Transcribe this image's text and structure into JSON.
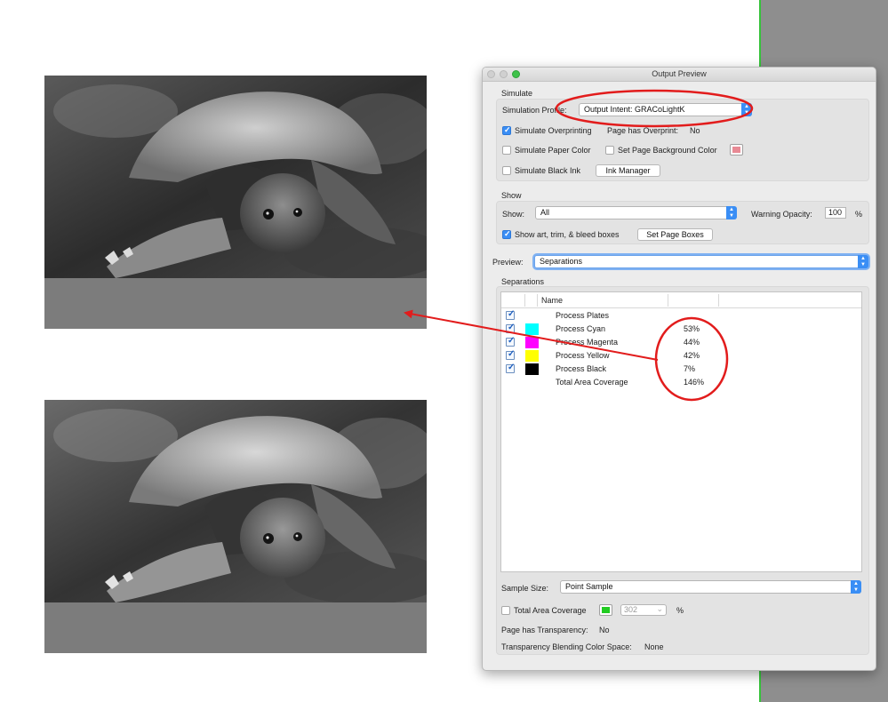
{
  "colors": {
    "annotation_red": "#e21c1c",
    "cyan": "#00ffff",
    "magenta": "#ff00ff",
    "yellow": "#ffff00",
    "black": "#000000",
    "green_swatch": "#22cc22",
    "pink_swatch": "#e88a95"
  },
  "dialog": {
    "title": "Output Preview",
    "simulate": {
      "section_label": "Simulate",
      "profile_label": "Simulation Profile:",
      "profile_value": "Output Intent: GRACoLightK",
      "simulate_overprinting_label": "Simulate Overprinting",
      "simulate_overprinting_checked": true,
      "page_has_overprint_label": "Page has Overprint:",
      "page_has_overprint_value": "No",
      "simulate_paper_color_label": "Simulate Paper Color",
      "set_page_bg_label": "Set Page Background Color",
      "simulate_black_ink_label": "Simulate Black Ink",
      "ink_manager_label": "Ink Manager"
    },
    "show": {
      "section_label": "Show",
      "show_label": "Show:",
      "show_value": "All",
      "warning_opacity_label": "Warning Opacity:",
      "warning_opacity_value": "100",
      "percent": "%",
      "show_boxes_label": "Show art, trim, & bleed boxes",
      "show_boxes_checked": true,
      "set_page_boxes_label": "Set Page Boxes"
    },
    "preview": {
      "label": "Preview:",
      "value": "Separations"
    },
    "separations": {
      "section_label": "Separations",
      "column_name": "Name",
      "rows": [
        {
          "name": "Process Plates",
          "percent": "",
          "swatch": ""
        },
        {
          "name": "Process Cyan",
          "percent": "53%",
          "swatch": "#00ffff"
        },
        {
          "name": "Process Magenta",
          "percent": "44%",
          "swatch": "#ff00ff"
        },
        {
          "name": "Process Yellow",
          "percent": "42%",
          "swatch": "#ffff00"
        },
        {
          "name": "Process Black",
          "percent": "7%",
          "swatch": "#000000"
        },
        {
          "name": "Total Area Coverage",
          "percent": "146%",
          "swatch": ""
        }
      ]
    },
    "bottom": {
      "sample_size_label": "Sample Size:",
      "sample_size_value": "Point Sample",
      "total_area_coverage_label": "Total Area Coverage",
      "tac_value": "302",
      "percent": "%",
      "page_has_transparency_label": "Page has Transparency:",
      "page_has_transparency_value": "No",
      "blending_label": "Transparency Blending Color Space:",
      "blending_value": "None"
    }
  }
}
